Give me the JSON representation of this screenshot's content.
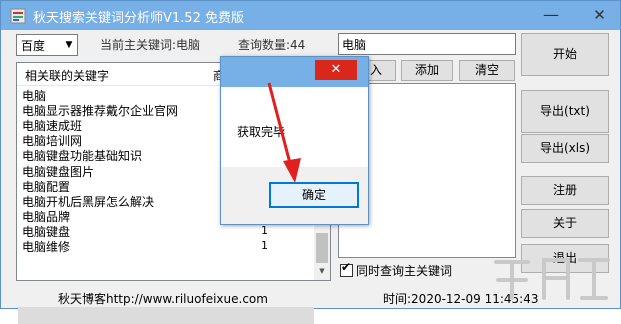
{
  "window": {
    "title": "秋天搜索关键词分析师V1.52 免费版",
    "minimize": "—",
    "close": "✕"
  },
  "toolbar": {
    "engine": "百度",
    "current_keyword": "当前主关键词:电脑",
    "query_count": "查询数量:44",
    "keyword_value": "电脑",
    "import_label": "入",
    "add_label": "添加",
    "clear_label": "清空"
  },
  "list": {
    "col_keyword": "相关联的关键字",
    "col_second": "商",
    "rows": [
      {
        "keyword": "电脑",
        "count": ""
      },
      {
        "keyword": "电脑显示器推荐戴尔企业官网",
        "count": ""
      },
      {
        "keyword": "电脑速成班",
        "count": ""
      },
      {
        "keyword": "电脑培训网",
        "count": ""
      },
      {
        "keyword": "电脑键盘功能基础知识",
        "count": ""
      },
      {
        "keyword": "电脑键盘图片",
        "count": ""
      },
      {
        "keyword": "电脑配置",
        "count": ""
      },
      {
        "keyword": "电脑开机后黑屏怎么解决",
        "count": ""
      },
      {
        "keyword": "电脑品牌",
        "count": ""
      },
      {
        "keyword": "电脑键盘",
        "count": "1"
      },
      {
        "keyword": "电脑维修",
        "count": "1"
      }
    ]
  },
  "right_buttons": {
    "start": "开始",
    "export_txt": "导出(txt)",
    "export_xls": "导出(xls)",
    "register": "注册",
    "about": "关于",
    "exit": "退出"
  },
  "checkbox": {
    "label": "同时查询主关键词",
    "checked": true,
    "mark": "✔"
  },
  "statusbar": {
    "blog": "秋天博客http://www.riluofeixue.com",
    "time": "时间:2020-12-09 11:45:43"
  },
  "dialog": {
    "message": "获取完毕",
    "ok": "确定",
    "close": "✕"
  },
  "colors": {
    "titlebar": "#77b0e6",
    "close_red": "#d9271c",
    "arrow_red": "#e02020",
    "selection": "#0078d7"
  }
}
